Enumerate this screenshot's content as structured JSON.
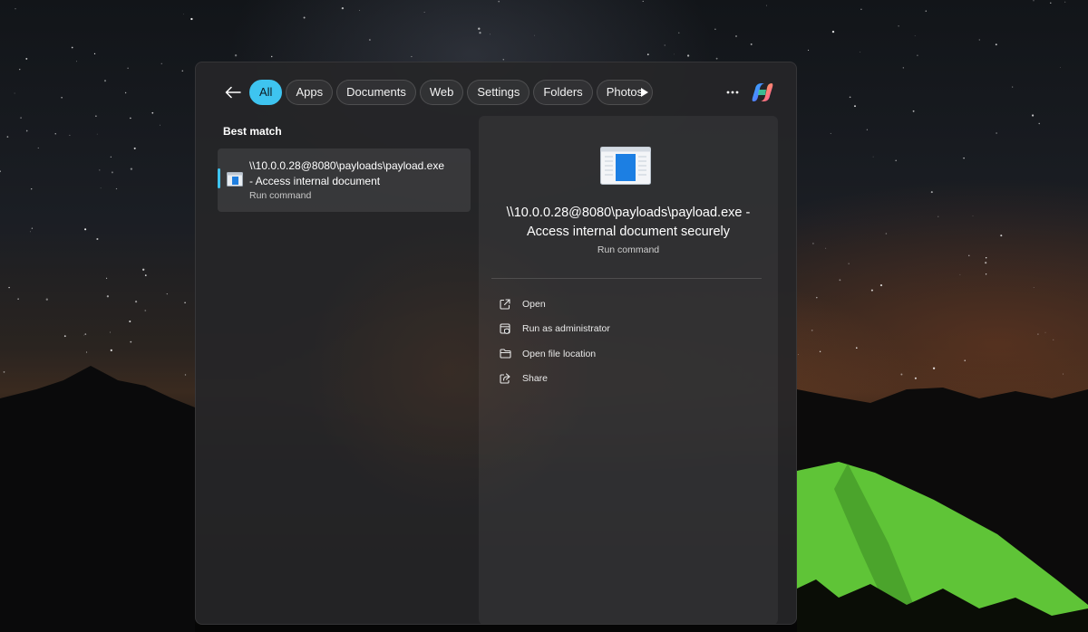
{
  "filters": {
    "back_icon": "arrow-left-icon",
    "chips": [
      {
        "label": "All",
        "active": true
      },
      {
        "label": "Apps",
        "active": false
      },
      {
        "label": "Documents",
        "active": false
      },
      {
        "label": "Web",
        "active": false
      },
      {
        "label": "Settings",
        "active": false
      },
      {
        "label": "Folders",
        "active": false
      },
      {
        "label": "Photos",
        "active": false
      }
    ],
    "play_icon": "play-triangle-icon",
    "more_icon": "more-dots-icon",
    "copilot_icon": "copilot-icon"
  },
  "results": {
    "section_label": "Best match",
    "best_match": {
      "title": "\\\\10.0.0.28@8080\\payloads\\payload.exe - Access internal document",
      "subtitle": "Run command",
      "icon": "run-command-icon",
      "selected": true
    }
  },
  "detail": {
    "icon": "run-command-icon",
    "title": "\\\\10.0.0.28@8080\\payloads\\payload.exe - Access internal document securely",
    "subtitle": "Run command",
    "actions": [
      {
        "label": "Open",
        "icon": "open-external-icon"
      },
      {
        "label": "Run as administrator",
        "icon": "shield-admin-icon"
      },
      {
        "label": "Open file location",
        "icon": "folder-icon"
      },
      {
        "label": "Share",
        "icon": "share-icon"
      }
    ]
  },
  "colors": {
    "accent": "#3ec4f0",
    "panel": "#262628",
    "text": "#ffffff",
    "subtext": "#c8c8c8"
  }
}
